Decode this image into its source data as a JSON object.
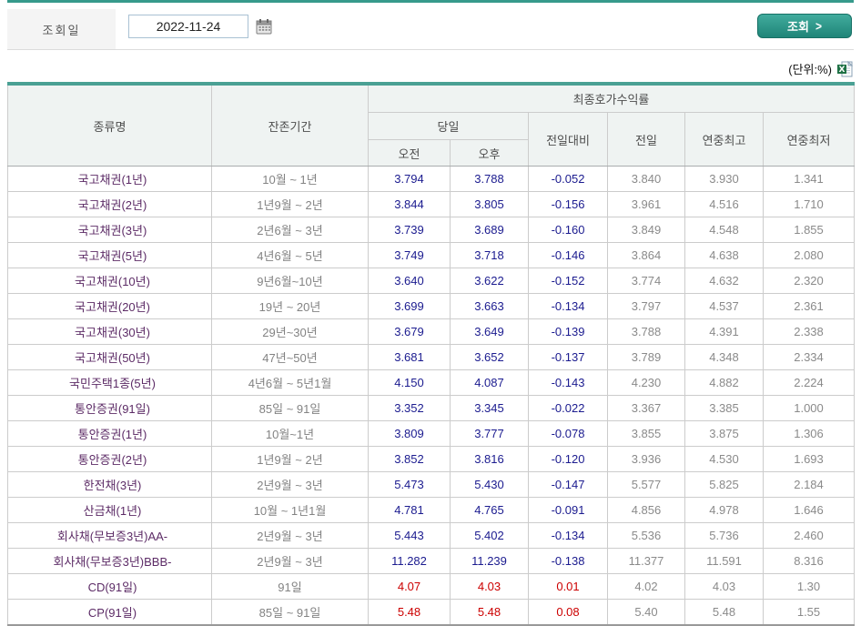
{
  "search": {
    "label": "조회일",
    "date_value": "2022-11-24",
    "button_label": "조회",
    "button_arrow": ">"
  },
  "unit_note": "(단위:%)",
  "colors": {
    "teal_top": "#379a8c",
    "teal_table": "#4aa094",
    "down": "#1b1b8f",
    "up": "#cc0000",
    "muted": "#8a8a8a",
    "bond_name": "#5c2b66"
  },
  "table": {
    "headers": {
      "type": "종류명",
      "period": "잔존기간",
      "yield_group": "최종호가수익률",
      "today": "당일",
      "am": "오전",
      "pm": "오후",
      "day_change": "전일대비",
      "prev_day": "전일",
      "year_high": "연중최고",
      "year_low": "연중최저"
    },
    "rows": [
      {
        "name": "국고채권(1년)",
        "period": "10월 ~ 1년",
        "am": "3.794",
        "pm": "3.788",
        "change": "-0.052",
        "prev": "3.840",
        "high": "3.930",
        "low": "1.341",
        "trend": "down",
        "group_start": false
      },
      {
        "name": "국고채권(2년)",
        "period": "1년9월 ~ 2년",
        "am": "3.844",
        "pm": "3.805",
        "change": "-0.156",
        "prev": "3.961",
        "high": "4.516",
        "low": "1.710",
        "trend": "down",
        "group_start": false
      },
      {
        "name": "국고채권(3년)",
        "period": "2년6월 ~ 3년",
        "am": "3.739",
        "pm": "3.689",
        "change": "-0.160",
        "prev": "3.849",
        "high": "4.548",
        "low": "1.855",
        "trend": "down",
        "group_start": false
      },
      {
        "name": "국고채권(5년)",
        "period": "4년6월 ~ 5년",
        "am": "3.749",
        "pm": "3.718",
        "change": "-0.146",
        "prev": "3.864",
        "high": "4.638",
        "low": "2.080",
        "trend": "down",
        "group_start": false
      },
      {
        "name": "국고채권(10년)",
        "period": "9년6월~10년",
        "am": "3.640",
        "pm": "3.622",
        "change": "-0.152",
        "prev": "3.774",
        "high": "4.632",
        "low": "2.320",
        "trend": "down",
        "group_start": false
      },
      {
        "name": "국고채권(20년)",
        "period": "19년 ~ 20년",
        "am": "3.699",
        "pm": "3.663",
        "change": "-0.134",
        "prev": "3.797",
        "high": "4.537",
        "low": "2.361",
        "trend": "down",
        "group_start": false
      },
      {
        "name": "국고채권(30년)",
        "period": "29년~30년",
        "am": "3.679",
        "pm": "3.649",
        "change": "-0.139",
        "prev": "3.788",
        "high": "4.391",
        "low": "2.338",
        "trend": "down",
        "group_start": false
      },
      {
        "name": "국고채권(50년)",
        "period": "47년~50년",
        "am": "3.681",
        "pm": "3.652",
        "change": "-0.137",
        "prev": "3.789",
        "high": "4.348",
        "low": "2.334",
        "trend": "down",
        "group_start": false
      },
      {
        "name": "국민주택1종(5년)",
        "period": "4년6월 ~ 5년1월",
        "am": "4.150",
        "pm": "4.087",
        "change": "-0.143",
        "prev": "4.230",
        "high": "4.882",
        "low": "2.224",
        "trend": "down",
        "group_start": true
      },
      {
        "name": "통안증권(91일)",
        "period": "85일 ~ 91일",
        "am": "3.352",
        "pm": "3.345",
        "change": "-0.022",
        "prev": "3.367",
        "high": "3.385",
        "low": "1.000",
        "trend": "down",
        "group_start": false
      },
      {
        "name": "통안증권(1년)",
        "period": "10월~1년",
        "am": "3.809",
        "pm": "3.777",
        "change": "-0.078",
        "prev": "3.855",
        "high": "3.875",
        "low": "1.306",
        "trend": "down",
        "group_start": false
      },
      {
        "name": "통안증권(2년)",
        "period": "1년9월 ~ 2년",
        "am": "3.852",
        "pm": "3.816",
        "change": "-0.120",
        "prev": "3.936",
        "high": "4.530",
        "low": "1.693",
        "trend": "down",
        "group_start": false
      },
      {
        "name": "한전채(3년)",
        "period": "2년9월 ~ 3년",
        "am": "5.473",
        "pm": "5.430",
        "change": "-0.147",
        "prev": "5.577",
        "high": "5.825",
        "low": "2.184",
        "trend": "down",
        "group_start": true
      },
      {
        "name": "산금채(1년)",
        "period": "10월 ~ 1년1월",
        "am": "4.781",
        "pm": "4.765",
        "change": "-0.091",
        "prev": "4.856",
        "high": "4.978",
        "low": "1.646",
        "trend": "down",
        "group_start": false
      },
      {
        "name": "회사채(무보증3년)AA-",
        "period": "2년9월 ~ 3년",
        "am": "5.443",
        "pm": "5.402",
        "change": "-0.134",
        "prev": "5.536",
        "high": "5.736",
        "low": "2.460",
        "trend": "down",
        "group_start": false
      },
      {
        "name": "회사채(무보증3년)BBB-",
        "period": "2년9월 ~ 3년",
        "am": "11.282",
        "pm": "11.239",
        "change": "-0.138",
        "prev": "11.377",
        "high": "11.591",
        "low": "8.316",
        "trend": "down",
        "group_start": false
      },
      {
        "name": "CD(91일)",
        "period": "91일",
        "am": "4.07",
        "pm": "4.03",
        "change": "0.01",
        "prev": "4.02",
        "high": "4.03",
        "low": "1.30",
        "trend": "up",
        "group_start": true
      },
      {
        "name": "CP(91일)",
        "period": "85일 ~ 91일",
        "am": "5.48",
        "pm": "5.48",
        "change": "0.08",
        "prev": "5.40",
        "high": "5.48",
        "low": "1.55",
        "trend": "up",
        "group_start": false
      }
    ]
  }
}
